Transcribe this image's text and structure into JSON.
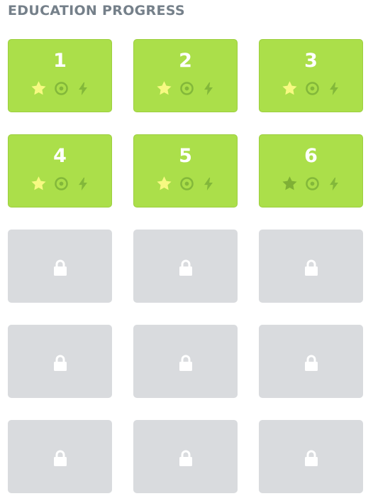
{
  "heading": "EDUCATION PROGRESS",
  "colors": {
    "unlocked_bg": "#abdf4a",
    "locked_bg": "#d9dbde",
    "star_earned": "#f6f982",
    "star_unearned": "#7fb035",
    "icon_muted": "#83b83a",
    "heading": "#75808a"
  },
  "levels": [
    {
      "number": "1",
      "state": "unlocked",
      "star_earned": true
    },
    {
      "number": "2",
      "state": "unlocked",
      "star_earned": true
    },
    {
      "number": "3",
      "state": "unlocked",
      "star_earned": true
    },
    {
      "number": "4",
      "state": "unlocked",
      "star_earned": true
    },
    {
      "number": "5",
      "state": "unlocked",
      "star_earned": true
    },
    {
      "number": "6",
      "state": "unlocked",
      "star_earned": false
    },
    {
      "state": "locked"
    },
    {
      "state": "locked"
    },
    {
      "state": "locked"
    },
    {
      "state": "locked"
    },
    {
      "state": "locked"
    },
    {
      "state": "locked"
    },
    {
      "state": "locked"
    },
    {
      "state": "locked"
    },
    {
      "state": "locked"
    }
  ],
  "icons": {
    "star": "star-icon",
    "target": "target-icon",
    "bolt": "lightning-icon",
    "lock": "lock-icon"
  }
}
